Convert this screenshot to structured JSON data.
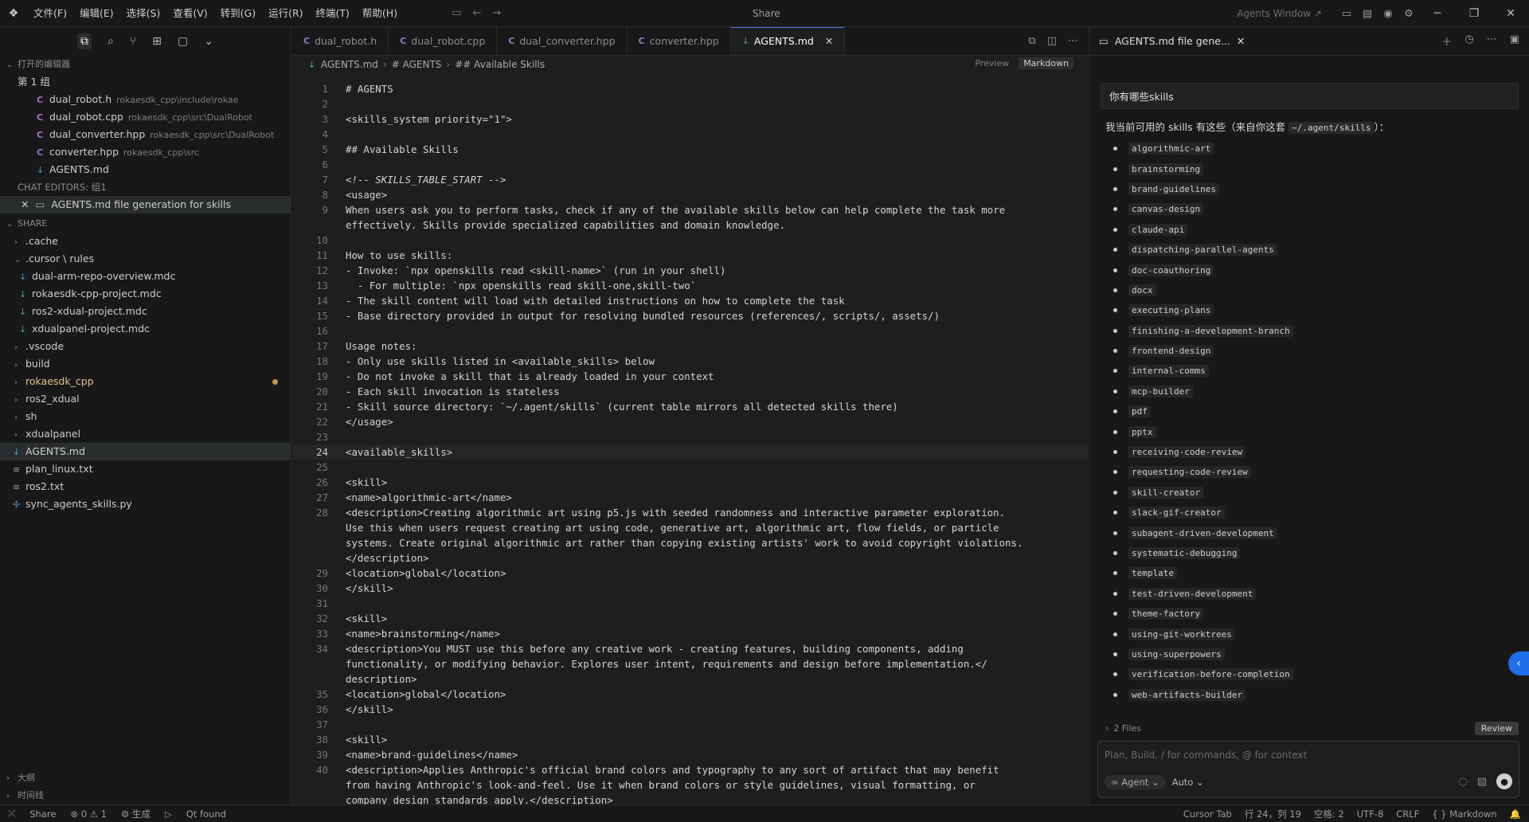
{
  "titlebar": {
    "menu": [
      "文件(F)",
      "编辑(E)",
      "选择(S)",
      "查看(V)",
      "转到(G)",
      "运行(R)",
      "终端(T)",
      "帮助(H)"
    ],
    "title": "Share",
    "agents_window": "Agents Window ↗"
  },
  "sidebar": {
    "open_editors_header": "打开的编辑器",
    "group_label": "第 1 组",
    "open_editors": [
      {
        "name": "dual_robot.h",
        "path": "rokaesdk_cpp\\include\\rokae",
        "icon": "c-icon"
      },
      {
        "name": "dual_robot.cpp",
        "path": "rokaesdk_cpp\\src\\DualRobot",
        "icon": "c-icon"
      },
      {
        "name": "dual_converter.hpp",
        "path": "rokaesdk_cpp\\src\\DualRobot",
        "icon": "c-icon"
      },
      {
        "name": "converter.hpp",
        "path": "rokaesdk_cpp\\src",
        "icon": "c-icon"
      },
      {
        "name": "AGENTS.md",
        "path": "",
        "icon": "markdown-icon"
      }
    ],
    "chat_editors_header": "CHAT EDITORS: 组1",
    "chat_editor_item": "AGENTS.md file generation for skills",
    "share_header": "SHARE",
    "tree": {
      "cache": ".cache",
      "cursor_rules": ".cursor \\ rules",
      "rule_files": [
        "dual-arm-repo-overview.mdc",
        "rokaesdk-cpp-project.mdc",
        "ros2-xdual-project.mdc",
        "xdualpanel-project.mdc"
      ],
      "folders": [
        ".vscode",
        "build",
        "rokaesdk_cpp",
        "ros2_xdual",
        "sh",
        "xdualpanel"
      ],
      "files": [
        "AGENTS.md",
        "plan_linux.txt",
        "ros2.txt",
        "sync_agents_skills.py"
      ]
    },
    "outline": "大纲",
    "timeline": "时间线"
  },
  "editor": {
    "tabs": [
      "dual_robot.h",
      "dual_robot.cpp",
      "dual_converter.hpp",
      "converter.hpp",
      "AGENTS.md"
    ],
    "breadcrumb": [
      "AGENTS.md",
      "# AGENTS",
      "## Available Skills"
    ],
    "preview": "Preview",
    "markdown": "Markdown",
    "lines": {
      "l1": "# AGENTS",
      "l3": "<skills_system priority=\"1\">",
      "l5": "## Available Skills",
      "l7": "<!-- SKILLS_TABLE_START -->",
      "l8": "<usage>",
      "l9a": "When users ask you to perform tasks, check if any of the available skills below can help complete the task more",
      "l9b": "effectively. Skills provide specialized capabilities and domain knowledge.",
      "l11": "How to use skills:",
      "l12": "- Invoke: `npx openskills read <skill-name>` (run in your shell)",
      "l13": "  - For multiple: `npx openskills read skill-one,skill-two`",
      "l14": "- The skill content will load with detailed instructions on how to complete the task",
      "l15": "- Base directory provided in output for resolving bundled resources (references/, scripts/, assets/)",
      "l17": "Usage notes:",
      "l18": "- Only use skills listed in <available_skills> below",
      "l19": "- Do not invoke a skill that is already loaded in your context",
      "l20": "- Each skill invocation is stateless",
      "l21": "- Skill source directory: `~/.agent/skills` (current table mirrors all detected skills there)",
      "l22": "</usage>",
      "l24": "<available_skills>",
      "l26": "<skill>",
      "l27": "<name>algorithmic-art</name>",
      "l28a": "<description>Creating algorithmic art using p5.js with seeded randomness and interactive parameter exploration.",
      "l28b": "Use this when users request creating art using code, generative art, algorithmic art, flow fields, or particle",
      "l28c": "systems. Create original algorithmic art rather than copying existing artists' work to avoid copyright violations.",
      "l28d": "</description>",
      "l29": "<location>global</location>",
      "l30": "</skill>",
      "l32": "<skill>",
      "l33": "<name>brainstorming</name>",
      "l34a": "<description>You MUST use this before any creative work - creating features, building components, adding",
      "l34b": "functionality, or modifying behavior. Explores user intent, requirements and design before implementation.</",
      "l34c": "description>",
      "l35": "<location>global</location>",
      "l36": "</skill>",
      "l38": "<skill>",
      "l39": "<name>brand-guidelines</name>",
      "l40a": "<description>Applies Anthropic's official brand colors and typography to any sort of artifact that may benefit",
      "l40b": "from having Anthropic's look-and-feel. Use it when brand colors or style guidelines, visual formatting, or",
      "l40c": "company design standards apply.</description>"
    }
  },
  "chat": {
    "tab_title": "AGENTS.md file gene...",
    "user_message": "你有哪些skills",
    "reply_intro": "我当前可用的 skills 有这些（来自你这套",
    "reply_path": "~/.agent/skills",
    "reply_end": "）：",
    "skills": [
      "algorithmic-art",
      "brainstorming",
      "brand-guidelines",
      "canvas-design",
      "claude-api",
      "dispatching-parallel-agents",
      "doc-coauthoring",
      "docx",
      "executing-plans",
      "finishing-a-development-branch",
      "frontend-design",
      "internal-comms",
      "mcp-builder",
      "pdf",
      "pptx",
      "receiving-code-review",
      "requesting-code-review",
      "skill-creator",
      "slack-gif-creator",
      "subagent-driven-development",
      "systematic-debugging",
      "template",
      "test-driven-development",
      "theme-factory",
      "using-git-worktrees",
      "using-superpowers",
      "verification-before-completion",
      "web-artifacts-builder"
    ],
    "files_label": "2 Files",
    "review_label": "Review",
    "composer_placeholder": "Plan, Build, / for commands, @ for context",
    "agent_mode": "Agent",
    "model": "Auto"
  },
  "statusbar": {
    "share": "Share",
    "problems": "0 ⚠ 1",
    "generate": "生成",
    "qt": "Qt found",
    "cursor_tab": "Cursor Tab",
    "position": "行 24，列 19",
    "spaces": "空格: 2",
    "encoding": "UTF-8",
    "eol": "CRLF",
    "language": "Markdown"
  }
}
